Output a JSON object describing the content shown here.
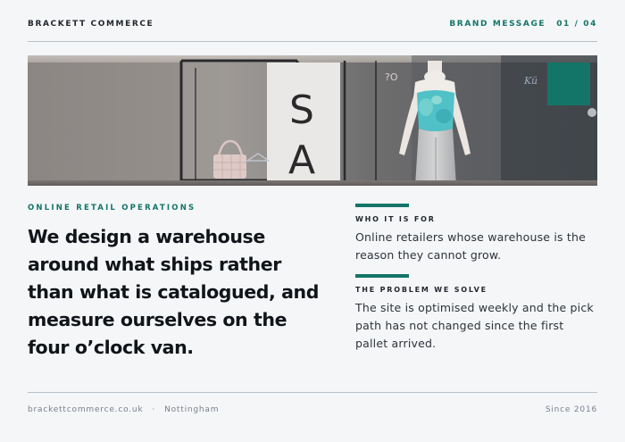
{
  "header": {
    "brand": "BRACKETT COMMERCE",
    "section": "BRAND MESSAGE",
    "page": "01 / 04"
  },
  "hero": {
    "image": "store-window-mannequin-photo",
    "sign_letters": [
      "S",
      "A"
    ],
    "accent_color": "#137567"
  },
  "main": {
    "eyebrow": "ONLINE RETAIL OPERATIONS",
    "headline": "We design a warehouse around what ships rather than what is catalogued, and measure ourselves on the four o’clock van."
  },
  "details": [
    {
      "label": "WHO IT IS FOR",
      "text": "Online retailers whose warehouse is the reason they cannot grow."
    },
    {
      "label": "THE PROBLEM WE SOLVE",
      "text": "The site is optimised weekly and the pick path has not changed since the first pallet arrived."
    }
  ],
  "footer": {
    "website": "brackettcommerce.co.uk",
    "separator": "·",
    "city": "Nottingham",
    "since": "Since 2016"
  },
  "colors": {
    "accent": "#137567",
    "background": "#f4f6f8",
    "text": "#111418"
  }
}
